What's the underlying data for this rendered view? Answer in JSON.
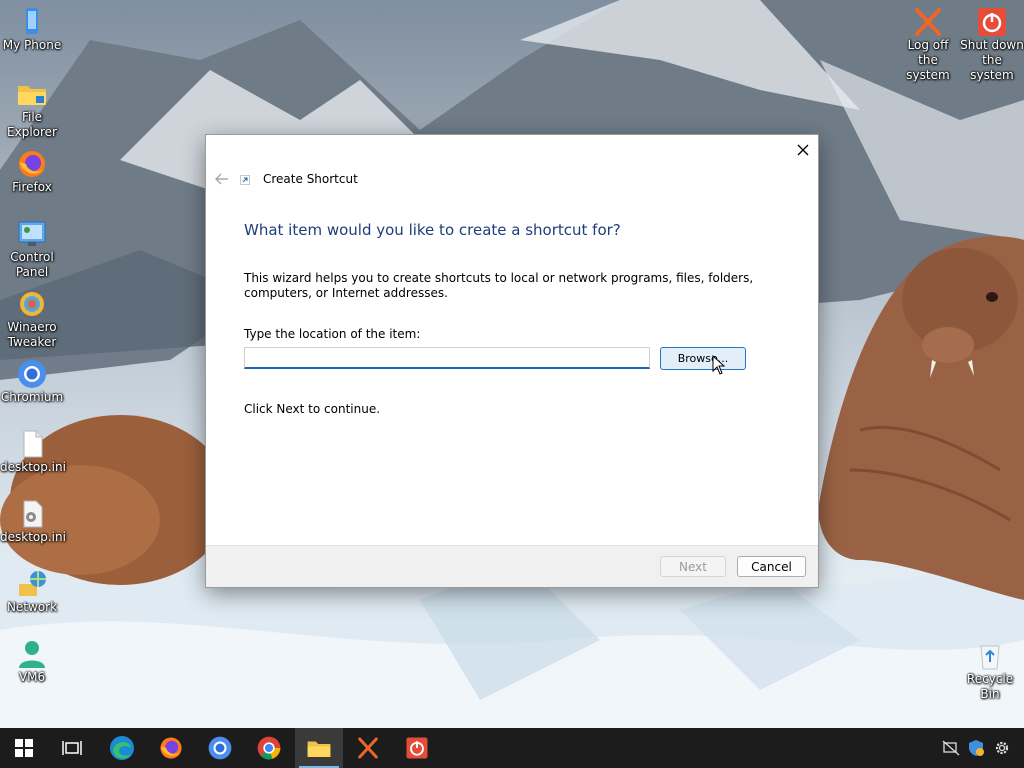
{
  "desktop": {
    "left_icons": [
      {
        "label": "My Phone",
        "icon": "phone-icon"
      },
      {
        "label": "File Explorer",
        "icon": "folder-icon"
      },
      {
        "label": "Firefox",
        "icon": "firefox-icon"
      },
      {
        "label": "Control Panel",
        "icon": "control-panel-icon"
      },
      {
        "label": "Winaero Tweaker",
        "icon": "winaero-tweaker-icon"
      },
      {
        "label": "Chromium",
        "icon": "chromium-icon"
      },
      {
        "label": "desktop.ini",
        "icon": "ini-file-icon"
      },
      {
        "label": "desktop.ini",
        "icon": "ini-file-gear-icon"
      },
      {
        "label": "Network",
        "icon": "network-icon"
      },
      {
        "label": "VM6",
        "icon": "user-icon"
      }
    ],
    "right_icons": [
      {
        "label": "Log off the system",
        "icon": "logoff-icon"
      },
      {
        "label": "Shut down the system",
        "icon": "shutdown-icon"
      },
      {
        "label": "Recycle Bin",
        "icon": "recycle-bin-icon"
      }
    ]
  },
  "dialog": {
    "title": "Create Shortcut",
    "heading": "What item would you like to create a shortcut for?",
    "description": "This wizard helps you to create shortcuts to local or network programs, files, folders, computers, or Internet addresses.",
    "location_label": "Type the location of the item:",
    "location_value": "",
    "browse_label": "Browse...",
    "continue_note": "Click Next to continue.",
    "next_label": "Next",
    "cancel_label": "Cancel"
  },
  "taskbar": {
    "apps": [
      "start-icon",
      "task-view-icon",
      "edge-icon",
      "firefox-icon",
      "chromium-icon",
      "chrome-icon",
      "file-explorer-icon",
      "logoff-icon",
      "shutdown-icon"
    ],
    "active_app": "file-explorer-icon",
    "tray": [
      "network-disconnected-icon",
      "security-icon",
      "settings-icon"
    ]
  },
  "colors": {
    "heading": "#1f3d7a",
    "input_underline": "#1e64b4",
    "browse_border": "#2a74c8",
    "taskbar": "#1c1c1c"
  }
}
